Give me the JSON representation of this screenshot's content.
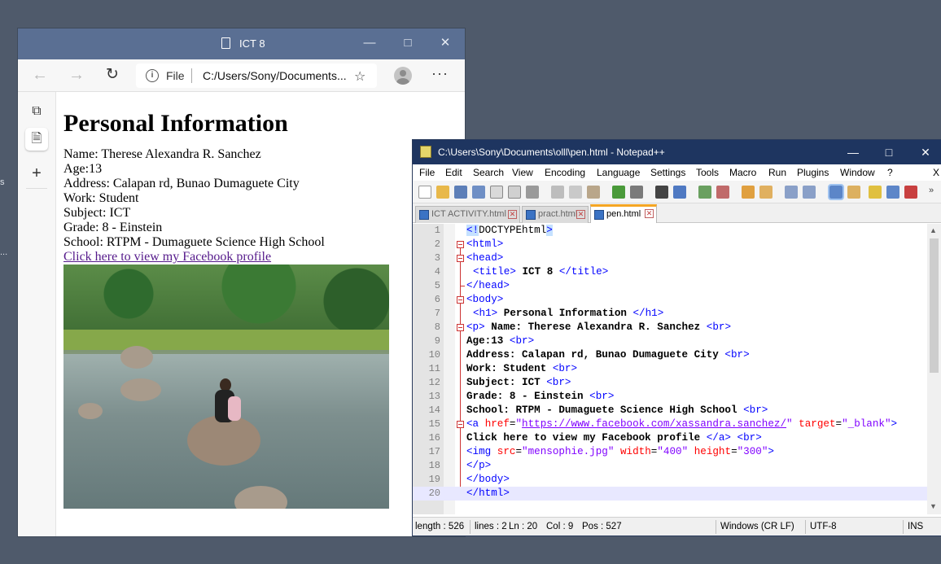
{
  "desktop": {
    "marks": [
      "s",
      "..."
    ]
  },
  "browser": {
    "title": "ICT 8",
    "address_scheme": "File",
    "address_url": "C:/Users/Sony/Documents...",
    "page": {
      "heading": "Personal Information",
      "lines": [
        "Name: Therese Alexandra R. Sanchez",
        "Age:13",
        "Address: Calapan rd, Bunao Dumaguete City",
        "Work: Student",
        "Subject: ICT",
        "Grade: 8 - Einstein",
        "School: RTPM - Dumaguete Science High School"
      ],
      "link": "Click here to view my Facebook profile"
    }
  },
  "npp": {
    "title": "C:\\Users\\Sony\\Documents\\olll\\pen.html - Notepad++",
    "menu": [
      "File",
      "Edit",
      "Search",
      "View",
      "Encoding",
      "Language",
      "Settings",
      "Tools",
      "Macro",
      "Run",
      "Plugins",
      "Window",
      "?",
      "X"
    ],
    "tabs": [
      "ICT ACTIVITY.html",
      "pract.html",
      "pen.html"
    ],
    "line_numbers": [
      "1",
      "2",
      "3",
      "4",
      "5",
      "6",
      "7",
      "8",
      "9",
      "10",
      "11",
      "12",
      "13",
      "14",
      "15",
      "16",
      "17",
      "18",
      "19",
      "20"
    ],
    "code": {
      "l1_tag": "<!",
      "l1_rest": "DOCTYPEhtml",
      "l1_end": ">",
      "l2": "<html>",
      "l3": "<head>",
      "l4_open": "<title>",
      "l4_text": " ICT 8 ",
      "l4_close": "</title>",
      "l5": "</head>",
      "l6": "<body>",
      "l7_open": "<h1>",
      "l7_text": " Personal Information ",
      "l7_close": "</h1>",
      "l8_open": "<p>",
      "l8_text": " Name: Therese Alexandra R. Sanchez ",
      "br": "<br>",
      "l9_text": "Age:13 ",
      "l10_text": "Address: Calapan rd, Bunao Dumaguete City ",
      "l11_text": "Work: Student ",
      "l12_text": "Subject: ICT ",
      "l13_text": "Grade: 8 - Einstein ",
      "l14_text": "School: RTPM - Dumaguete Science High School ",
      "l15_open": "<a ",
      "l15_attr1": "href",
      "l15_eq": "=",
      "l15_q": "\"",
      "l15_url": "https://www.facebook.com/xassandra.sanchez/",
      "l15_attr2": "target",
      "l15_val2": "\"_blank\"",
      "l15_end": ">",
      "l16_text": "Click here to view my Facebook profile ",
      "l16_close": "</a>",
      "l17_open": "<img ",
      "l17_attr1": "src",
      "l17_val1": "\"mensophie.jpg\"",
      "l17_attr2": "width",
      "l17_val2": "\"400\"",
      "l17_attr3": "height",
      "l17_val3": "\"300\"",
      "l17_end": ">",
      "l18": "</p>",
      "l19": "</body>",
      "l20": "</html>"
    },
    "status": {
      "length": "length : 526",
      "lines": "lines : 2",
      "ln": "Ln : 20",
      "col": "Col : 9",
      "pos": "Pos : 527",
      "eol": "Windows (CR LF)",
      "encoding": "UTF-8",
      "mode": "INS"
    }
  }
}
